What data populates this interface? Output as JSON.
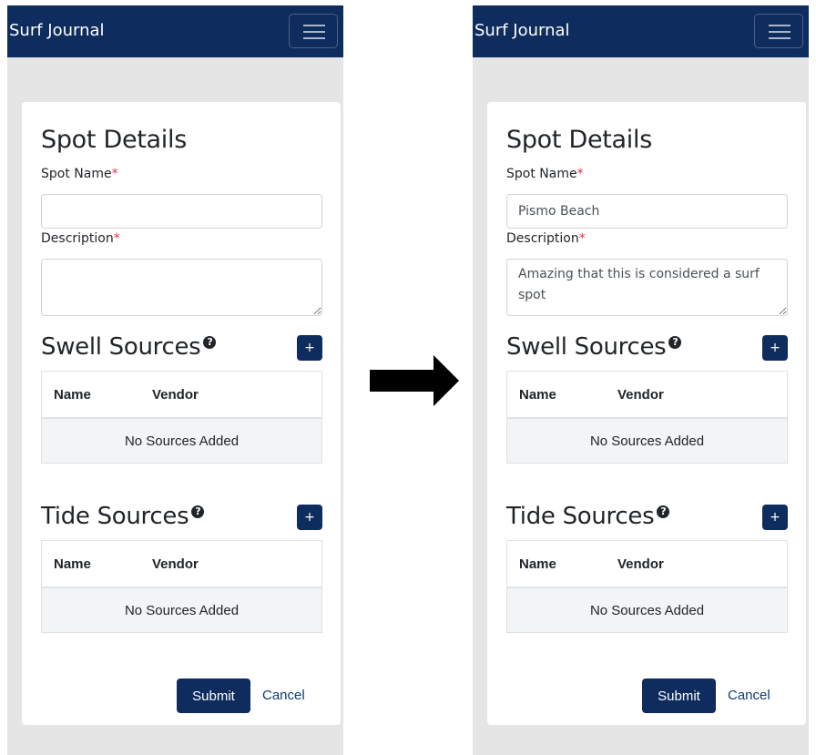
{
  "app": {
    "brand": "Surf Journal",
    "menu_icon": "hamburger-menu-icon",
    "accent_color": "#0f2c5e",
    "required_color": "#dc3545"
  },
  "form": {
    "title": "Spot Details",
    "spot_name_label": "Spot Name",
    "description_label": "Description",
    "required_mark": "*",
    "swell_title": "Swell Sources",
    "tide_title": "Tide Sources",
    "help_icon": "question-circle-icon",
    "add_label": "+",
    "table_headers": {
      "name": "Name",
      "vendor": "Vendor"
    },
    "empty_text": "No Sources Added",
    "submit_label": "Submit",
    "cancel_label": "Cancel"
  },
  "before": {
    "spot_name_value": "",
    "description_value": ""
  },
  "after": {
    "spot_name_value": "Pismo Beach",
    "description_value": "Amazing that this is considered a surf spot"
  },
  "transition_icon": "right-arrow-icon"
}
